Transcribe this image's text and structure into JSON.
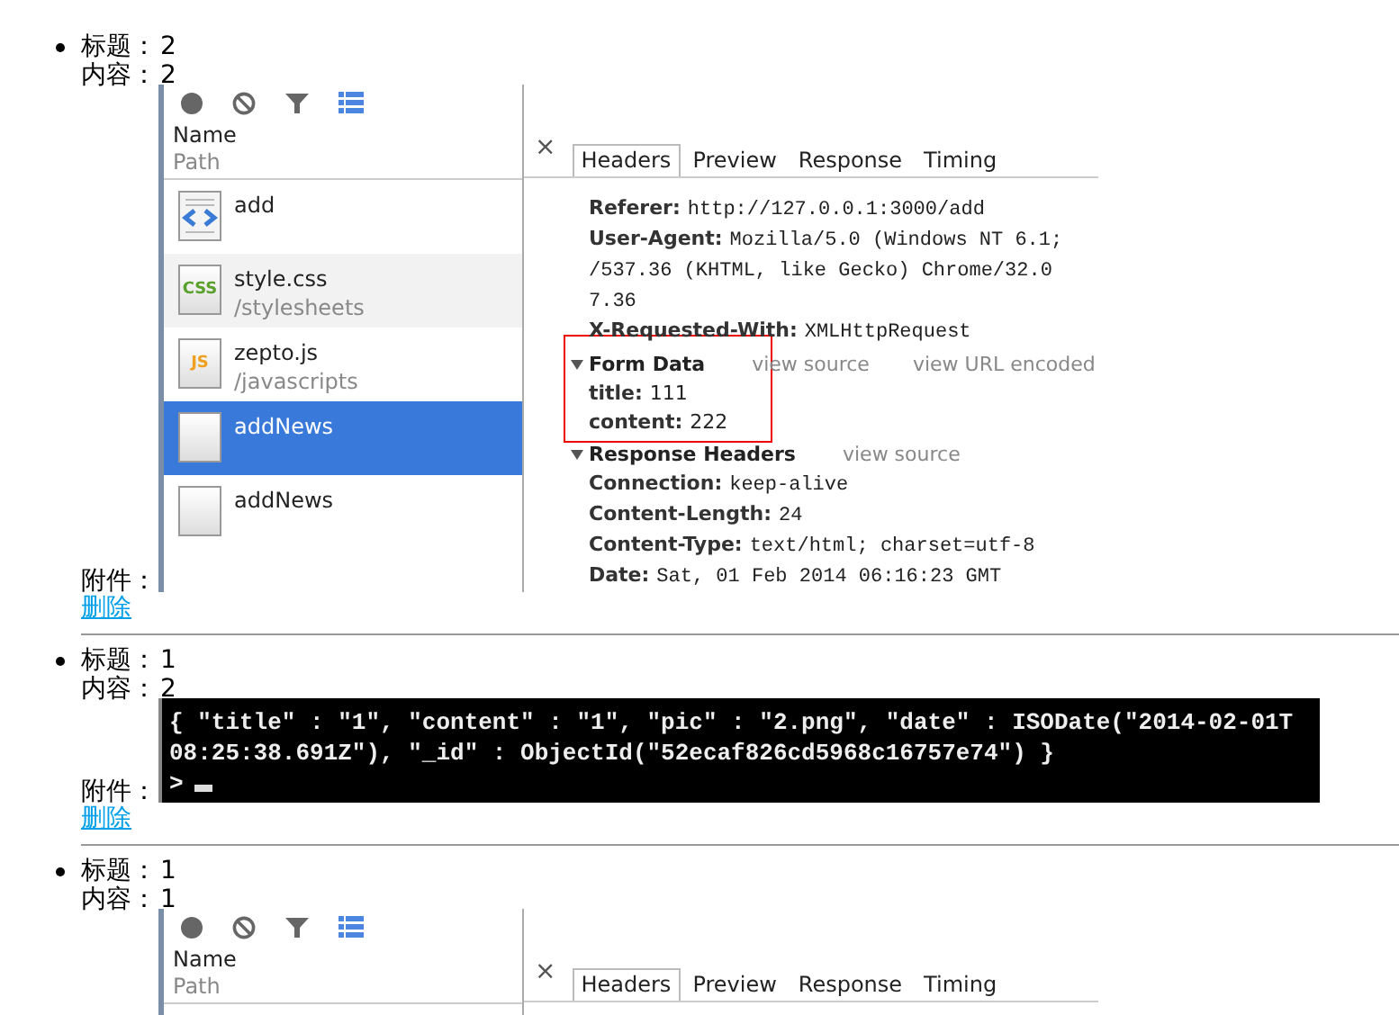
{
  "posts": [
    {
      "title_label": "标题：",
      "title": "2",
      "content_label": "内容：",
      "content": "2",
      "attachment_label": "附件：",
      "delete_link": "删除",
      "attachment": {
        "kind": "devtools",
        "toolbar": [
          {
            "kind": "record",
            "on": false
          },
          {
            "kind": "clear",
            "on": false
          },
          {
            "kind": "filter",
            "on": false
          },
          {
            "kind": "large-rows",
            "on": true
          }
        ],
        "name_heading": "Name",
        "path_heading": "Path",
        "requests": [
          {
            "name": "add",
            "kind": "html",
            "selected": false,
            "hovered": false
          },
          {
            "name": "style.css",
            "path": "/stylesheets",
            "kind": "css",
            "icon_label": "CSS",
            "selected": false,
            "hovered": true
          },
          {
            "name": "zepto.js",
            "path": "/javascripts",
            "kind": "js",
            "icon_label": "JS",
            "selected": false,
            "hovered": false
          },
          {
            "name": "addNews",
            "kind": "blank",
            "selected": true,
            "hovered": false
          },
          {
            "name": "addNews",
            "kind": "blank",
            "selected": false,
            "hovered": false
          }
        ],
        "close": "×",
        "tabs": [
          {
            "label": "Headers",
            "selected": true
          },
          {
            "label": "Preview",
            "selected": false
          },
          {
            "label": "Response",
            "selected": false
          },
          {
            "label": "Timing",
            "selected": false
          }
        ],
        "sections": [
          {
            "kind": "headers",
            "lines": [
              {
                "name": "Referer:",
                "value": "http://127.0.0.1:3000/add"
              },
              {
                "name": "User-Agent:",
                "value": "Mozilla/5.0 (Windows NT 6.1;"
              },
              {
                "value": "/537.36 (KHTML, like Gecko) Chrome/32.0"
              },
              {
                "value": "7.36"
              },
              {
                "name": "X-Requested-With:",
                "value": "XMLHttpRequest"
              }
            ]
          },
          {
            "kind": "params",
            "title": "Form Data",
            "expanded": true,
            "boxed": true,
            "links": [
              "view source",
              "view URL encoded"
            ],
            "lines": [
              {
                "name": "title:",
                "value": "111"
              },
              {
                "name": "content:",
                "value": "222"
              }
            ]
          },
          {
            "kind": "headers",
            "title": "Response Headers",
            "expanded": true,
            "boxed": false,
            "links": [
              "view source"
            ],
            "lines": [
              {
                "name": "Connection:",
                "value": "keep-alive"
              },
              {
                "name": "Content-Length:",
                "value": "24"
              },
              {
                "name": "Content-Type:",
                "value": "text/html; charset=utf-8"
              },
              {
                "name": "Date:",
                "value": "Sat, 01 Feb 2014 06:16:23 GMT"
              }
            ]
          }
        ]
      }
    },
    {
      "title_label": "标题：",
      "title": "1",
      "content_label": "内容：",
      "content": "2",
      "attachment_label": "附件：",
      "delete_link": "删除",
      "attachment": {
        "kind": "terminal",
        "lines": [
          "{ \"title\" : \"1\", \"content\" : \"1\", \"pic\" : \"2.png\", \"date\" : ISODate(\"2014-02-01T",
          "08:25:38.691Z\"), \"_id\" : ObjectId(\"52ecaf826cd5968c16757e74\") }"
        ],
        "prompt": ">"
      }
    },
    {
      "title_label": "标题：",
      "title": "1",
      "content_label": "内容：",
      "content": "1",
      "attachment": {
        "kind": "devtools",
        "toolbar": [
          {
            "kind": "record",
            "on": false
          },
          {
            "kind": "clear",
            "on": false
          },
          {
            "kind": "filter",
            "on": false
          },
          {
            "kind": "large-rows",
            "on": true
          }
        ],
        "name_heading": "Name",
        "path_heading": "Path",
        "close": "×",
        "tabs": [
          {
            "label": "Headers",
            "selected": true
          },
          {
            "label": "Preview",
            "selected": false
          },
          {
            "label": "Response",
            "selected": false
          },
          {
            "label": "Timing",
            "selected": false
          }
        ]
      }
    }
  ]
}
